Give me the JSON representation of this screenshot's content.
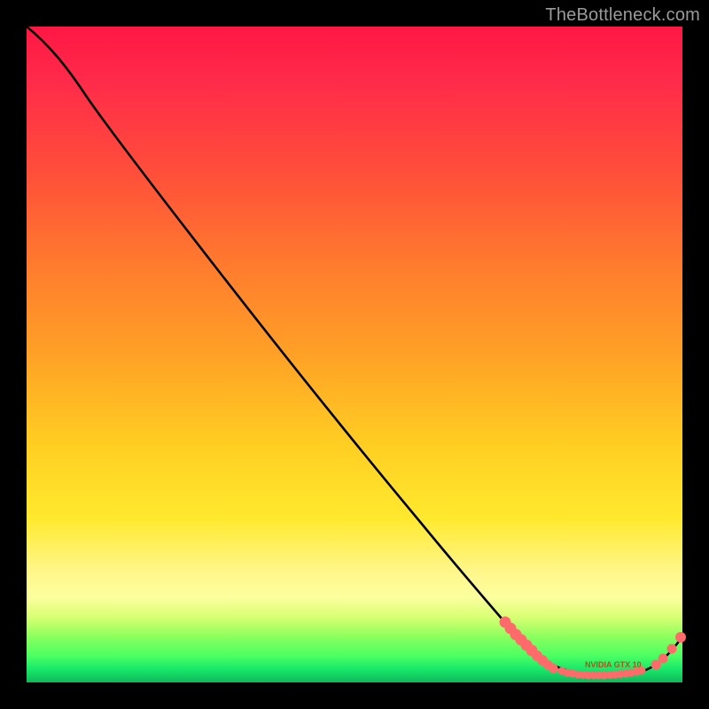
{
  "attribution": "TheBottleneck.com",
  "axis_label": "NVIDIA GTX 10",
  "colors": {
    "marker": "#ff6b6b",
    "curve": "#000000",
    "attribution": "#9a9a9a"
  },
  "chart_data": {
    "type": "line",
    "title": "",
    "xlabel": "",
    "ylabel": "",
    "xlim": [
      0,
      100
    ],
    "ylim": [
      0,
      100
    ],
    "grid": false,
    "legend": false,
    "series": [
      {
        "name": "bottleneck-curve",
        "x": [
          0,
          5,
          10,
          15,
          20,
          25,
          30,
          35,
          40,
          45,
          50,
          55,
          60,
          65,
          70,
          73,
          75,
          78,
          80,
          82,
          84,
          86,
          88,
          90,
          92,
          94,
          96,
          98,
          100
        ],
        "y": [
          100,
          97,
          93,
          87,
          81,
          75,
          69,
          63,
          57,
          51,
          45,
          39,
          33,
          27,
          21,
          16,
          13,
          9,
          6,
          4,
          2.5,
          1.5,
          1,
          1,
          1.3,
          2,
          3.2,
          5,
          8
        ]
      }
    ],
    "markers": {
      "cluster_left": {
        "x_range": [
          73,
          80
        ],
        "y_range": [
          6,
          16
        ],
        "count": 10
      },
      "cluster_floor": {
        "x_range": [
          82,
          94
        ],
        "y_range": [
          1,
          2.5
        ],
        "count": 16
      },
      "cluster_right": {
        "x_range": [
          96,
          99
        ],
        "y_range": [
          3,
          7
        ],
        "count": 4
      }
    }
  }
}
